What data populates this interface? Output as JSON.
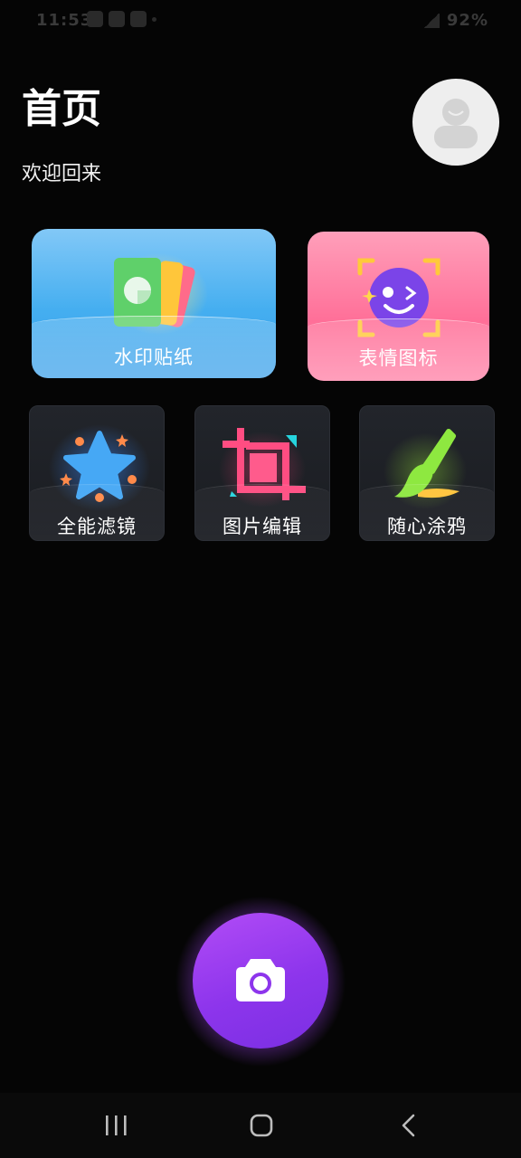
{
  "status_bar": {
    "time": "11:53",
    "battery": "92%"
  },
  "header": {
    "title": "首页",
    "subtitle": "欢迎回来"
  },
  "features": {
    "watermark_sticker": "水印贴纸",
    "emoji_icons": "表情图标",
    "all_filters": "全能滤镜",
    "image_edit": "图片编辑",
    "doodle": "随心涂鸦"
  },
  "icons": {
    "avatar": "user-avatar-icon",
    "camera": "camera-icon",
    "nav_recents": "recents-icon",
    "nav_home": "home-icon",
    "nav_back": "back-icon"
  },
  "colors": {
    "background": "#050505",
    "camera_accent": "#9b3ff0",
    "watermark_card": "#44aef0",
    "emoji_card": "#ff6f98",
    "dark_card": "#1f2227"
  }
}
